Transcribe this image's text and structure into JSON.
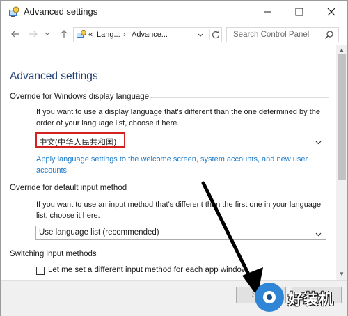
{
  "window": {
    "title": "Advanced settings"
  },
  "nav": {
    "breadcrumb_prefix": "«",
    "crumbs": [
      "Lang...",
      "Advance..."
    ],
    "search_placeholder": "Search Control Panel"
  },
  "page": {
    "title": "Advanced settings"
  },
  "display_language": {
    "heading": "Override for Windows display language",
    "description": "If you want to use a display language that's different than the one determined by the order of your language list, choose it here.",
    "selected": "中文(中华人民共和国)",
    "link": "Apply language settings to the welcome screen, system accounts, and new user accounts"
  },
  "input_method": {
    "heading": "Override for default input method",
    "description": "If you want to use an input method that's different than the first one in your language list, choose it here.",
    "selected": "Use language list (recommended)"
  },
  "switching": {
    "heading": "Switching input methods",
    "checkbox_label": "Let me set a different input method for each app window",
    "checked": false
  },
  "footer": {
    "save_label": "Save",
    "cancel_label": "Cancel"
  },
  "watermark": {
    "text": "好装机"
  },
  "colors": {
    "title_blue": "#1e3d73",
    "link_blue": "#1979ca",
    "highlight_red": "#d4201f",
    "arrow": "#000000"
  }
}
